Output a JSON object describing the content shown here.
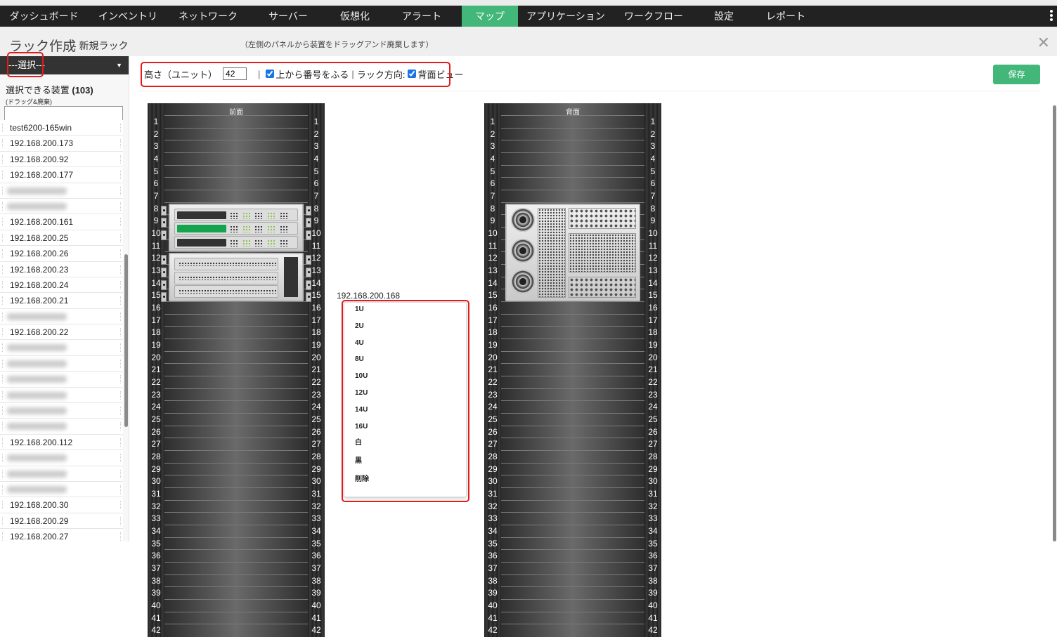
{
  "nav": {
    "items": [
      "ダッシュボード",
      "インベントリ",
      "ネットワーク",
      "サーバー",
      "仮想化",
      "アラート",
      "マップ",
      "アプリケーション",
      "ワークフロー",
      "設定",
      "レポート"
    ],
    "active_index": 6,
    "accent": "#43b77a"
  },
  "header": {
    "title": "ラック作成",
    "subtitle": "- 新規ラック",
    "hint": "（左側のパネルから装置をドラッグアンド廃棄します）",
    "close_icon": "close-icon"
  },
  "sidebar": {
    "select_label": "---選択---",
    "available_label": "選択できる装置",
    "available_count": "(103)",
    "drag_note": "(ドラッグ&廃棄)",
    "search_value": "",
    "items": [
      "test6200-165win",
      "192.168.200.173",
      "192.168.200.92",
      "192.168.200.177",
      null,
      null,
      "192.168.200.161",
      "192.168.200.25",
      "192.168.200.26",
      "192.168.200.23",
      "192.168.200.24",
      "192.168.200.21",
      null,
      "192.168.200.22",
      null,
      null,
      null,
      null,
      null,
      null,
      "192.168.200.112",
      null,
      null,
      null,
      "192.168.200.30",
      "192.168.200.29",
      "192.168.200.27"
    ]
  },
  "toolbar": {
    "height_label": "高さ（ユニット）",
    "height_value": "42",
    "sep": "|",
    "number_from_top_label": "上から番号をふる",
    "number_from_top_checked": true,
    "direction_label": "ラック方向:",
    "rear_view_label": "背面ビュー",
    "rear_view_checked": true,
    "save_label": "保存"
  },
  "racks": {
    "front": {
      "label": "前面",
      "devices": [
        {
          "type": "switch",
          "start": 8,
          "units": 4
        },
        {
          "type": "storage",
          "start": 12,
          "units": 4
        }
      ]
    },
    "rear": {
      "label": "背面",
      "devices": [
        {
          "type": "server-rear",
          "start": 8,
          "units": 8
        }
      ]
    }
  },
  "context_menu": {
    "device": "192.168.200.168",
    "items": [
      "1U",
      "2U",
      "4U",
      "8U",
      "10U",
      "12U",
      "14U",
      "16U",
      "白",
      "黒",
      "削除"
    ]
  }
}
